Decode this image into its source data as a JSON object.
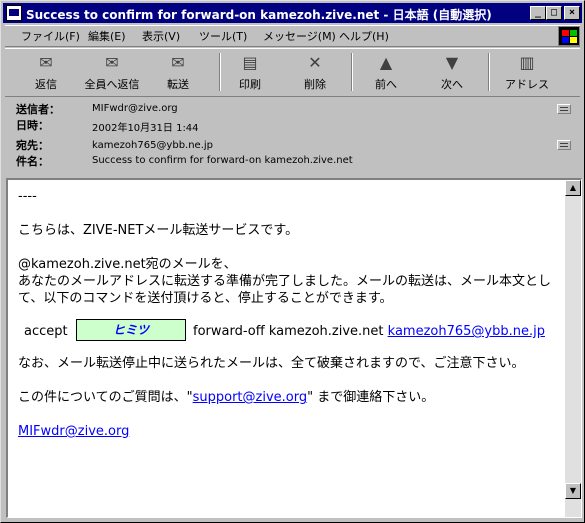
{
  "window": {
    "title": "Success to confirm for forward-on kamezoh.zive.net - 日本語 (自動選択)",
    "minimize": "_",
    "maximize": "□",
    "close": "×"
  },
  "menu": [
    {
      "label": "ファイル(F)"
    },
    {
      "label": "編集(E)"
    },
    {
      "label": "表示(V)"
    },
    {
      "label": "ツール(T)"
    },
    {
      "label": "メッセージ(M)"
    },
    {
      "label": "ヘルプ(H)"
    }
  ],
  "toolbar": [
    {
      "label": "返信",
      "icon": "reply-icon",
      "glyph": "✉"
    },
    {
      "label": "全員へ返信",
      "icon": "reply-all-icon",
      "glyph": "✉"
    },
    {
      "label": "転送",
      "icon": "forward-icon",
      "glyph": "✉"
    },
    {
      "label": "印刷",
      "icon": "print-icon",
      "glyph": "▤"
    },
    {
      "label": "削除",
      "icon": "delete-icon",
      "glyph": "✕"
    },
    {
      "label": "前へ",
      "icon": "previous-icon",
      "glyph": "▲"
    },
    {
      "label": "次へ",
      "icon": "next-icon",
      "glyph": "▼"
    },
    {
      "label": "アドレス",
      "icon": "address-book-icon",
      "glyph": "▥"
    }
  ],
  "header": {
    "from_label": "送信者：",
    "from_value": "MIFwdr@zive.org",
    "date_label": "日時：",
    "date_value": "2002年10月31日 1:44",
    "to_label": "宛先：",
    "to_value": "kamezoh765@ybb.ne.jp",
    "subject_label": "件名：",
    "subject_value": "Success to confirm for forward-on kamezoh.zive.net"
  },
  "body": {
    "separator": "----",
    "intro": "こちらは、ZIVE-NETメール転送サービスです。",
    "line1": "@kamezoh.zive.net宛のメールを、",
    "line2": "あなたのメールアドレスに転送する準備が完了しました。メールの転送は、メール本文として、以下のコマンドを送付頂けると、停止することができます。",
    "accept": "accept",
    "secret": "ヒミツ",
    "command": "forward-off kamezoh.zive.net",
    "command_email": "kamezoh765@ybb.ne.jp",
    "note": "なお、メール転送停止中に送られたメールは、全て破棄されますので、ご注意下さい。",
    "contact_pre": "この件についてのご質問は、\"",
    "contact_email": "support@zive.org",
    "contact_post": "\" まで御連絡下さい。",
    "signature": "MIFwdr@zive.org"
  },
  "scroll": {
    "up": "▲",
    "down": "▼"
  }
}
